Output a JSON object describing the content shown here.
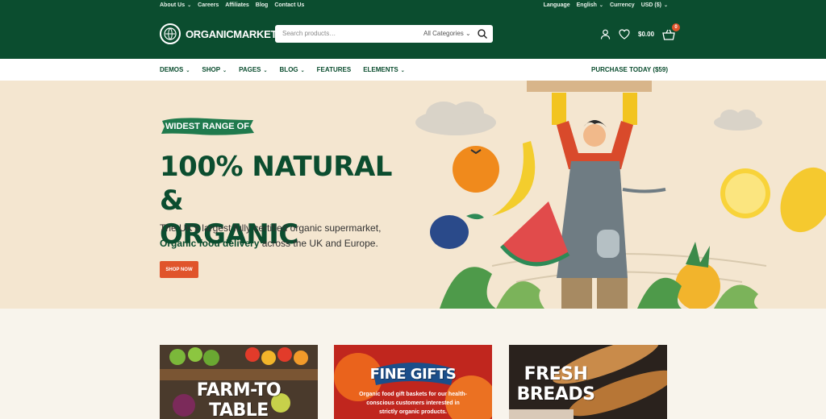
{
  "topbar": {
    "links": [
      "About Us",
      "Careers",
      "Affiliates",
      "Blog",
      "Contact Us"
    ],
    "language_label": "Language",
    "language_value": "English",
    "currency_label": "Currency",
    "currency_value": "USD ($)"
  },
  "header": {
    "logo_text": "ORGANICMARKET",
    "search_placeholder": "Search products…",
    "search_category": "All Categories",
    "cart_total": "$0.00",
    "cart_count": "0"
  },
  "nav": {
    "items": [
      {
        "label": "DEMOS",
        "has_menu": true
      },
      {
        "label": "SHOP",
        "has_menu": true
      },
      {
        "label": "PAGES",
        "has_menu": true
      },
      {
        "label": "BLOG",
        "has_menu": true
      },
      {
        "label": "FEATURES",
        "has_menu": false
      },
      {
        "label": "ELEMENTS",
        "has_menu": true
      }
    ],
    "purchase": "PURCHASE TODAY ($59)"
  },
  "hero": {
    "tag": "WIDEST RANGE OF",
    "headline_line1": "100% NATURAL &",
    "headline_line2": "ORGANIC",
    "subtitle_line1": "The UK's largest fully certified organic supermarket,",
    "subtitle_bold": "Organic food delivery",
    "subtitle_rest": " across the UK and Europe.",
    "cta": "SHOP NOW"
  },
  "cards": [
    {
      "title_line1": "FARM-TO",
      "title_line2": "TABLE",
      "description": ""
    },
    {
      "title_line1": "FINE GIFTS",
      "title_line2": "",
      "description": "Organic food gift baskets for our health-conscious customers interested in strictly organic products."
    },
    {
      "title_line1": "FRESH",
      "title_line2": "BREADS",
      "description": ""
    }
  ],
  "colors": {
    "brand_green": "#0b4d2f",
    "accent_orange": "#e0542b",
    "hero_bg": "#f4e6d0",
    "page_bg": "#f8f4ec"
  },
  "icons": [
    "globe-logo-icon",
    "search-icon",
    "user-icon",
    "heart-icon",
    "basket-icon",
    "chevron-down-icon"
  ]
}
